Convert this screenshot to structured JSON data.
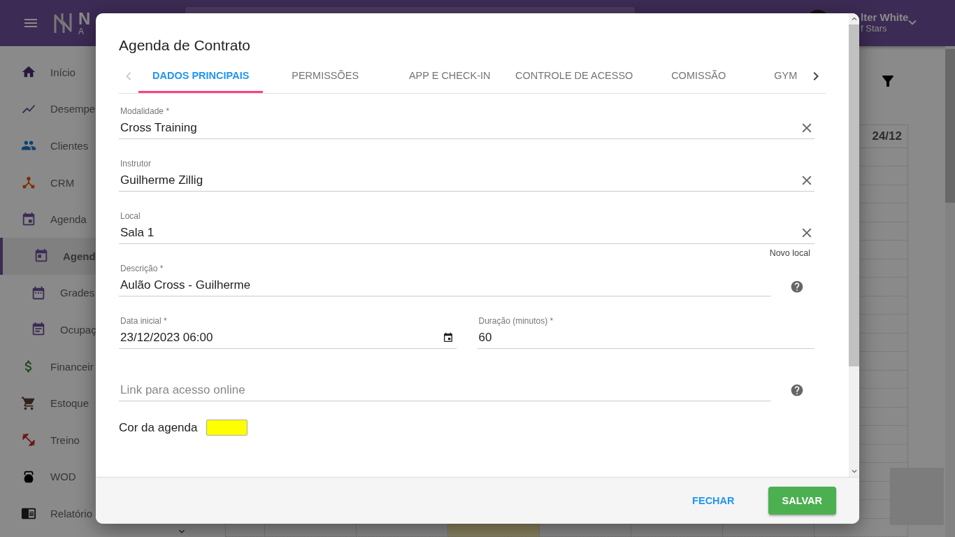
{
  "app_header": {
    "logo_title": "N",
    "logo_subtitle": "A",
    "user_name": "lter White",
    "user_subtitle": "f Stars"
  },
  "sidebar": {
    "items": [
      {
        "label": "Início",
        "selected": false
      },
      {
        "label": "Desempe",
        "selected": false
      },
      {
        "label": "Clientes",
        "selected": false
      },
      {
        "label": "CRM",
        "selected": false
      },
      {
        "label": "Agenda",
        "selected": false,
        "expanded": true,
        "children": [
          {
            "label": "Agend",
            "selected": true
          },
          {
            "label": "Grades",
            "selected": false
          },
          {
            "label": "Ocupaç",
            "selected": false
          }
        ]
      },
      {
        "label": "Financeir",
        "selected": false
      },
      {
        "label": "Estoque",
        "selected": false
      },
      {
        "label": "Treino",
        "selected": false
      },
      {
        "label": "WOD",
        "selected": false
      },
      {
        "label": "Relatório",
        "selected": false
      }
    ]
  },
  "calendar": {
    "day_header": "24/12"
  },
  "dialog": {
    "title": "Agenda de Contrato",
    "tabs": [
      {
        "label": "DADOS PRINCIPAIS",
        "selected": true
      },
      {
        "label": "PERMISSÕES",
        "selected": false
      },
      {
        "label": "APP E CHECK-IN",
        "selected": false
      },
      {
        "label": "CONTROLE DE ACESSO",
        "selected": false
      },
      {
        "label": "COMISSÃO",
        "selected": false
      },
      {
        "label": "GYM",
        "selected": false
      }
    ],
    "rows": [
      {
        "fields": [
          {
            "kind": "clearable",
            "label": "Modalidade *",
            "value": "Cross Training"
          }
        ]
      },
      {
        "fields": [
          {
            "kind": "clearable",
            "label": "Instrutor",
            "value": "Guilherme Zillig"
          }
        ]
      },
      {
        "fields": [
          {
            "kind": "clearable",
            "label": "Local",
            "value": "Sala 1",
            "link": "Novo local"
          }
        ]
      },
      {
        "fields": [
          {
            "kind": "help",
            "label": "Descrição *",
            "value": "Aulão Cross - Guilherme"
          }
        ]
      },
      {
        "fields": [
          {
            "kind": "datetime",
            "label": "Data inicial *",
            "value": "23/12/2023 06:00"
          },
          {
            "kind": "plain",
            "label": "Duração (minutos) *",
            "value": "60"
          }
        ]
      },
      {
        "fields": [
          {
            "kind": "help",
            "placeholder": "Link para acesso online"
          }
        ]
      }
    ],
    "color_picker": {
      "label": "Cor da agenda",
      "color": "#ffff00"
    },
    "buttons": [
      {
        "label": "FECHAR",
        "kind": "text"
      },
      {
        "label": "SALVAR",
        "kind": "primary"
      }
    ]
  }
}
